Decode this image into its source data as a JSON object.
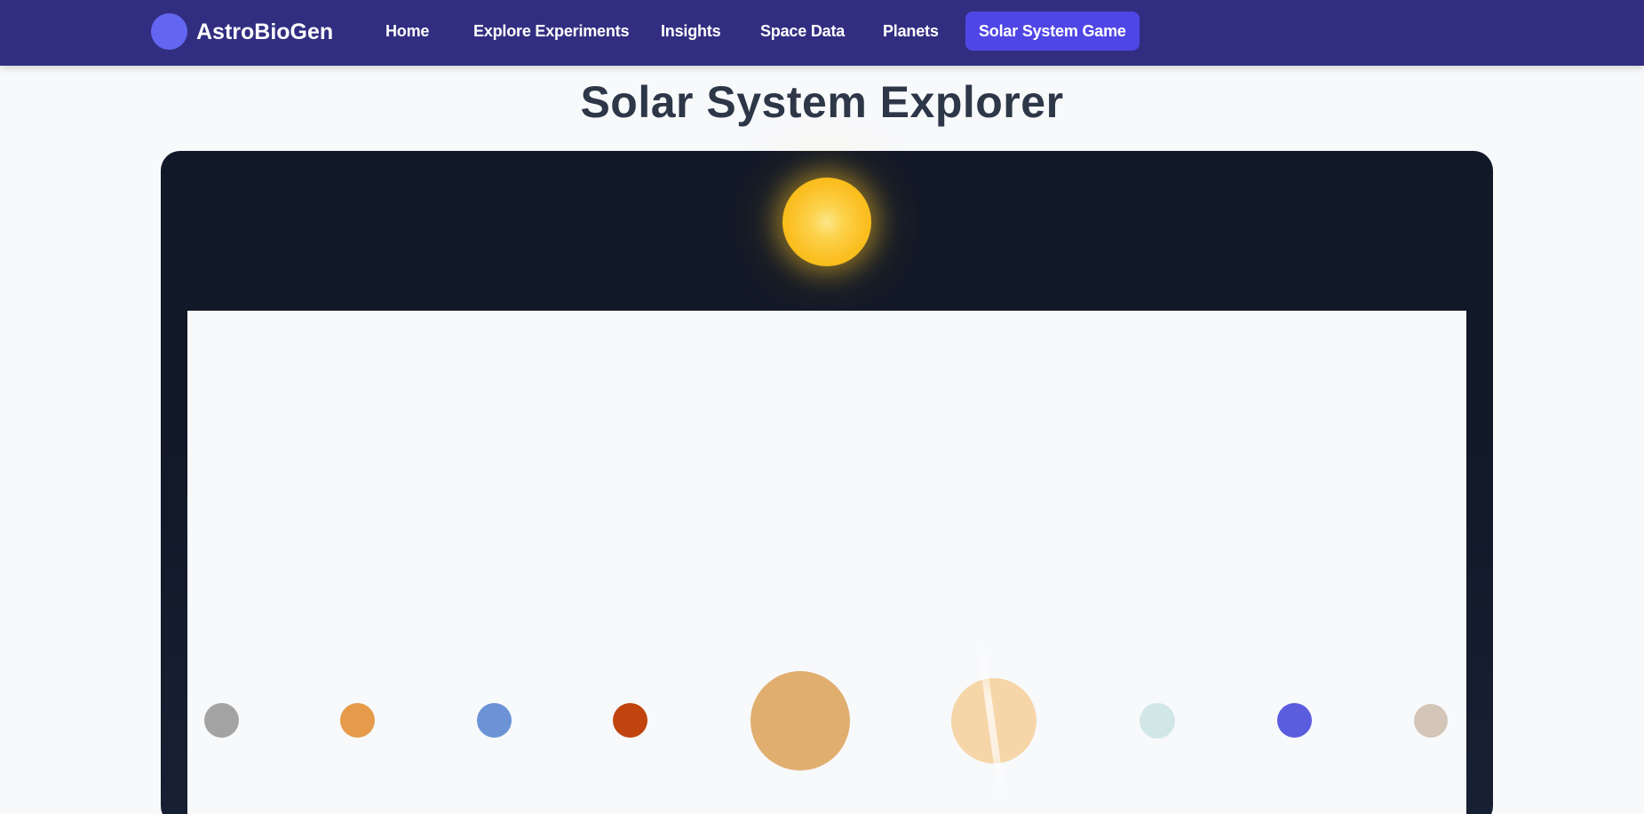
{
  "brand": {
    "name": "AstroBioGen"
  },
  "nav": {
    "items": [
      {
        "label": "Home"
      },
      {
        "label": "Explore Experiments"
      },
      {
        "label": "Insights"
      },
      {
        "label": "Space Data"
      },
      {
        "label": "Planets"
      },
      {
        "label": "Solar System Game"
      }
    ],
    "active": "Solar System Game"
  },
  "page": {
    "title": "Solar System Explorer"
  },
  "colors": {
    "navbar": "#312e81",
    "accent": "#4f46e5",
    "brand_dot": "#6366f1",
    "space": "#111827",
    "sun": "#fbbf24"
  },
  "solar_system": {
    "sun": {
      "icon": "sun-icon"
    },
    "planets": [
      {
        "id": "mercury",
        "color": "#a3a3a3"
      },
      {
        "id": "venus",
        "color": "#e59b4a"
      },
      {
        "id": "earth",
        "color": "#6b93d6"
      },
      {
        "id": "mars",
        "color": "#c1440e"
      },
      {
        "id": "jupiter",
        "color": "#e0ae6f"
      },
      {
        "id": "saturn",
        "color": "#f6d6a8"
      },
      {
        "id": "uranus",
        "color": "#d1e7e7"
      },
      {
        "id": "neptune",
        "color": "#5b5ddf"
      },
      {
        "id": "pluto",
        "color": "#d4c5b9"
      }
    ]
  }
}
